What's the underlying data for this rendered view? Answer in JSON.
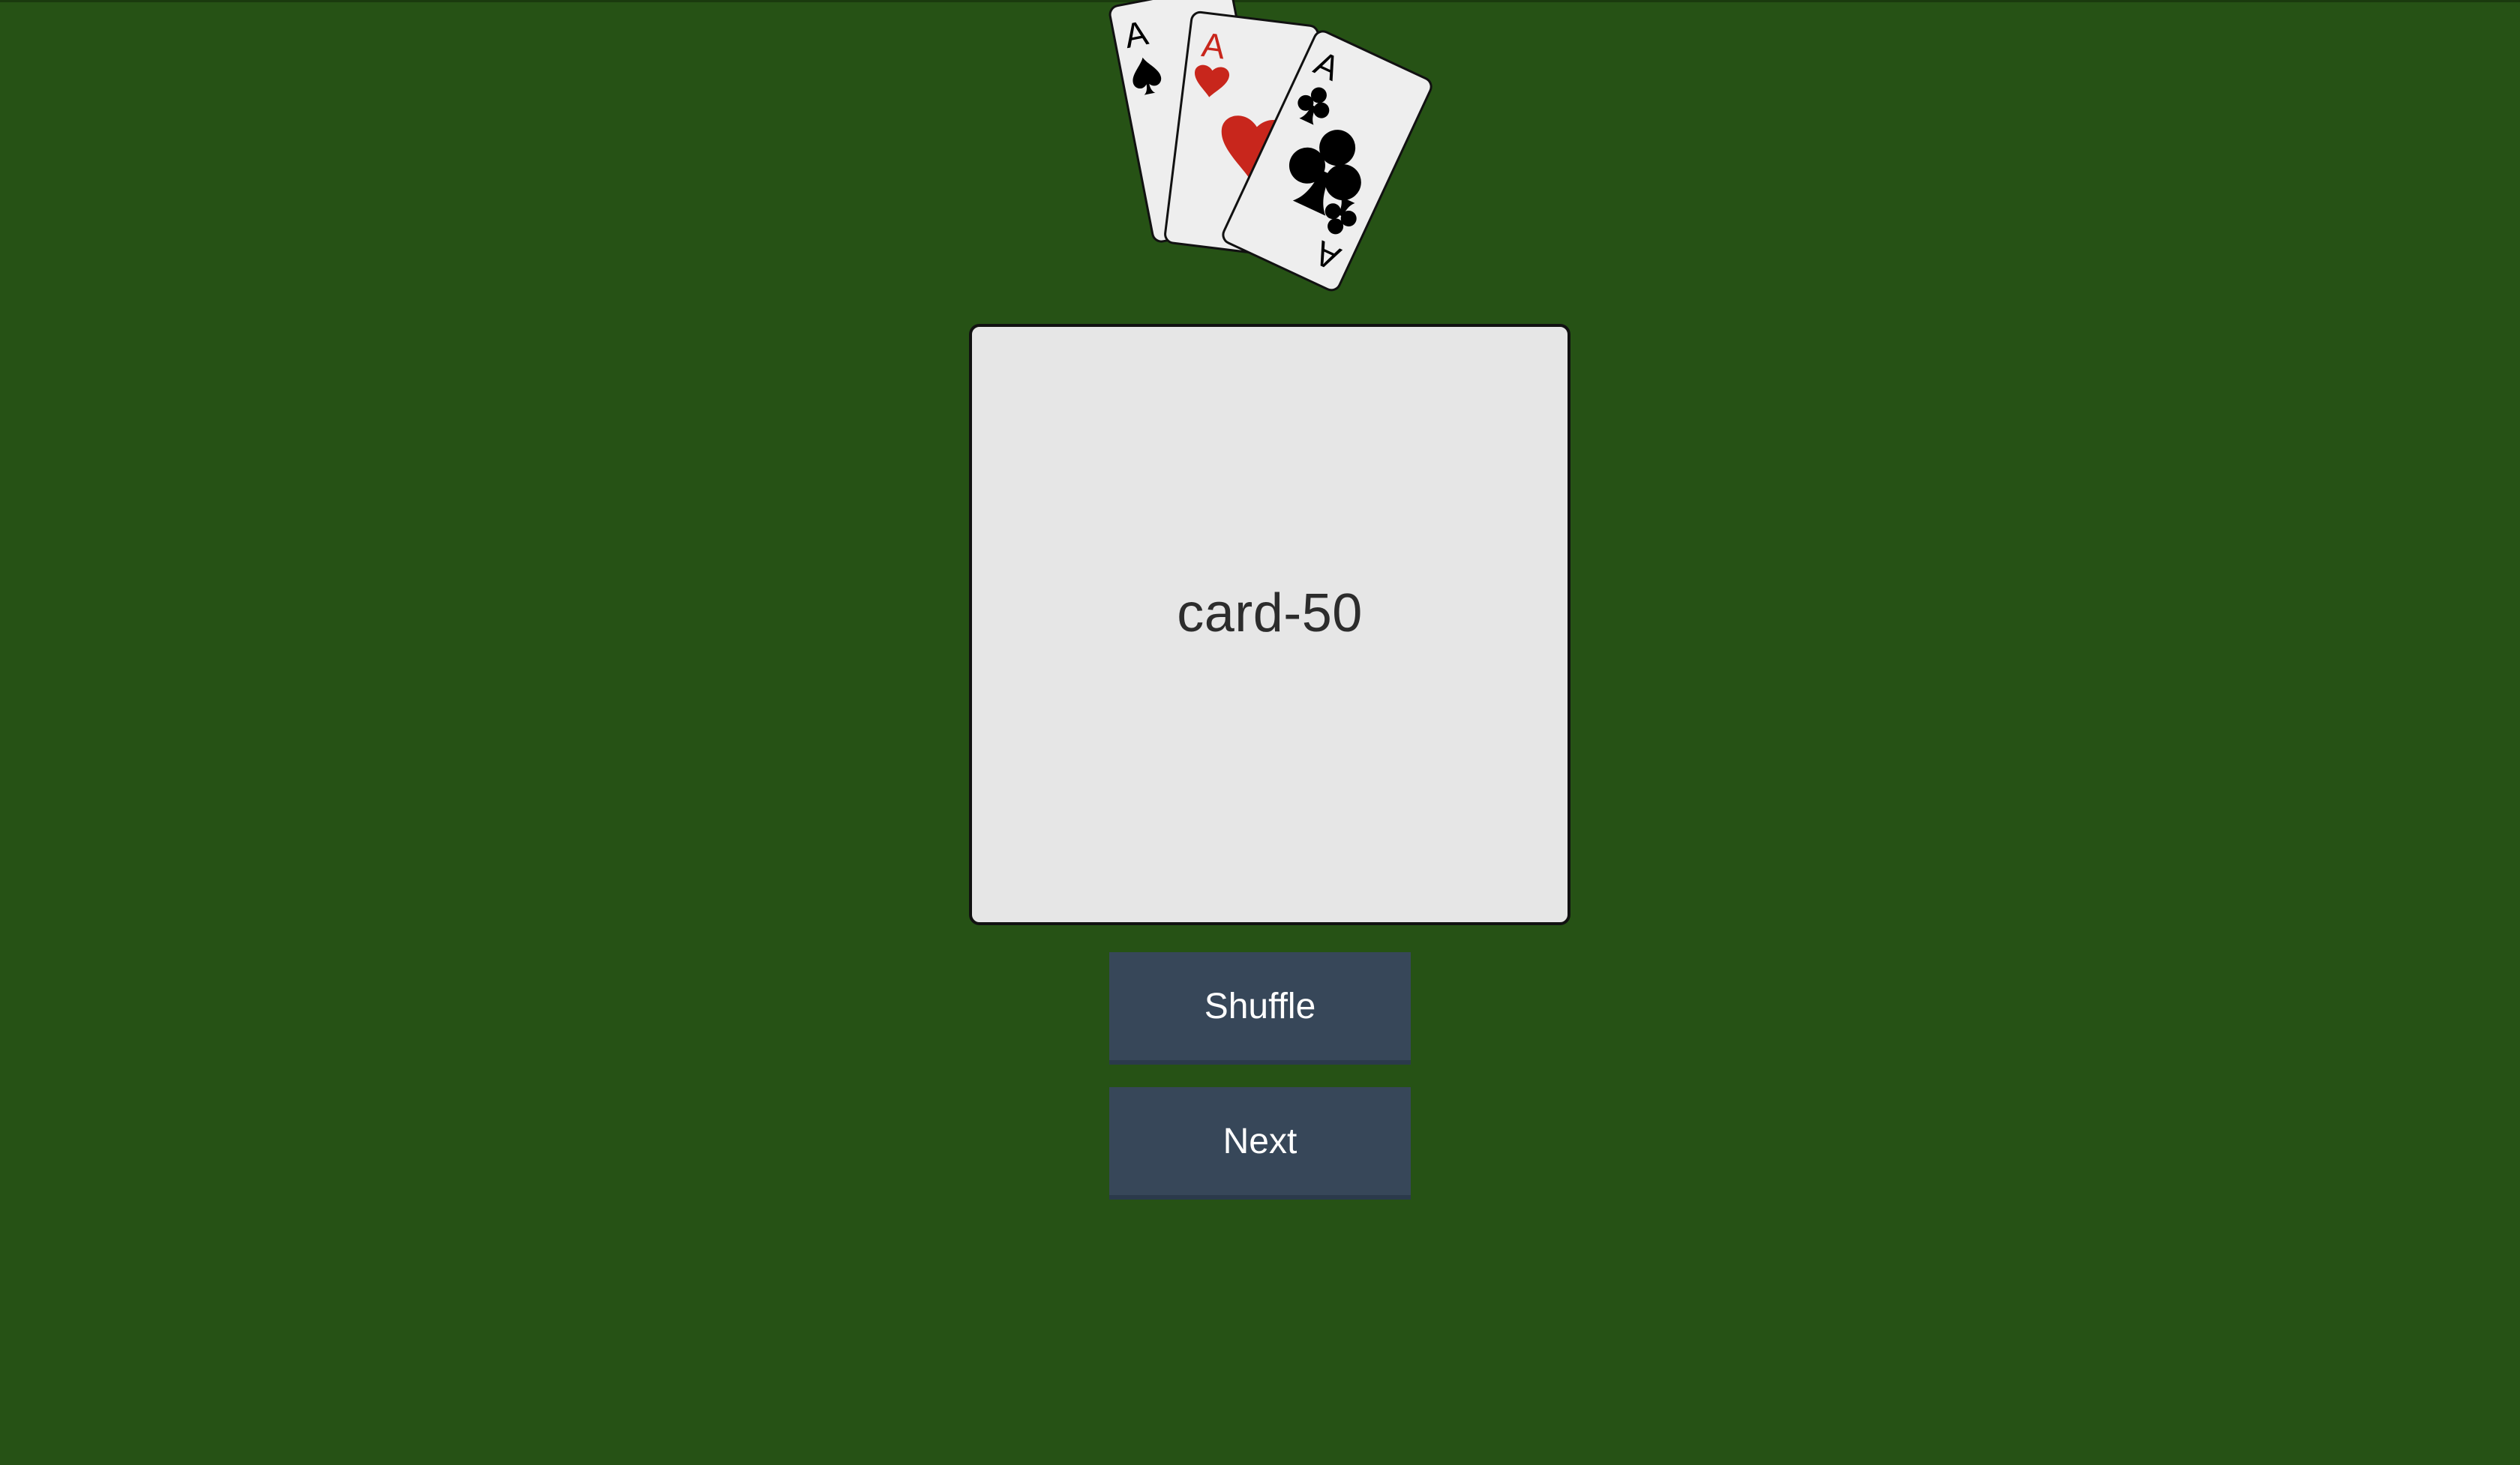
{
  "logo": {
    "icon": "three-aces-icon",
    "cards": [
      {
        "rank": "A",
        "suit": "spade",
        "color": "#000000"
      },
      {
        "rank": "A",
        "suit": "heart",
        "color": "#c8261c"
      },
      {
        "rank": "A",
        "suit": "club",
        "color": "#000000"
      }
    ]
  },
  "card": {
    "label": "card-50"
  },
  "buttons": {
    "shuffle_label": "Shuffle",
    "next_label": "Next"
  },
  "colors": {
    "table_green": "#265215",
    "card_face": "#e6e6e6",
    "button": "#374759",
    "heart_red": "#c8261c"
  }
}
